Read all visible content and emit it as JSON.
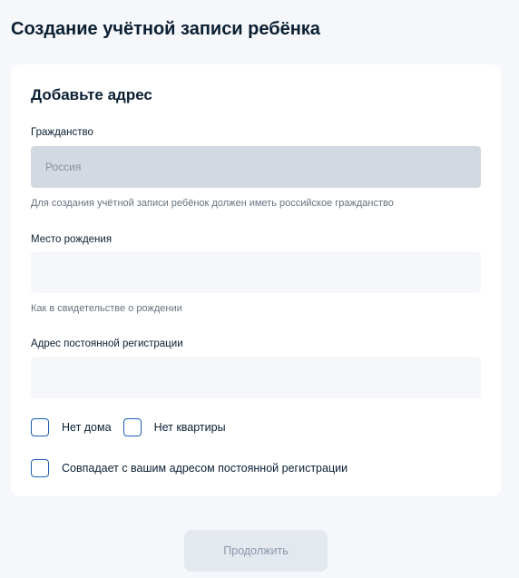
{
  "page": {
    "title": "Создание учётной записи ребёнка"
  },
  "form": {
    "title": "Добавьте адрес",
    "citizenship": {
      "label": "Гражданство",
      "value": "Россия",
      "hint": "Для создания учётной записи ребёнок должен иметь российское гражданство"
    },
    "birthplace": {
      "label": "Место рождения",
      "value": "",
      "hint": "Как в свидетельстве о рождении"
    },
    "registration": {
      "label": "Адрес постоянной регистрации",
      "value": ""
    },
    "checkboxes": {
      "no_house": "Нет дома",
      "no_apartment": "Нет квартиры",
      "same_address": "Совпадает с вашим адресом постоянной регистрации"
    }
  },
  "actions": {
    "continue_label": "Продолжить"
  }
}
